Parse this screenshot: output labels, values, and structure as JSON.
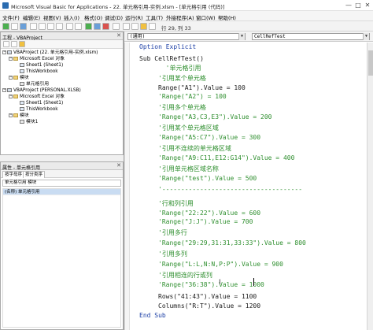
{
  "window": {
    "title": "Microsoft Visual Basic for Applications - 22. 单元格引用-实例.xlsm - [单元格引用 (代码)]",
    "minimize": "—",
    "maximize": "□",
    "close": "✕"
  },
  "menu": [
    "文件(F)",
    "编辑(E)",
    "视图(V)",
    "插入(I)",
    "格式(O)",
    "调试(D)",
    "运行(R)",
    "工具(T)",
    "外接程序(A)",
    "窗口(W)",
    "帮助(H)"
  ],
  "toolbar": {
    "position": "行 29, 列 33"
  },
  "project_panel": {
    "title": "工程 - VBAProject",
    "close": "✕",
    "tree": [
      {
        "label": "VBAProject (22. 单元格引用-实例.xlsm)",
        "toggle": "−",
        "icon": "proj"
      },
      {
        "label": "Microsoft Excel 对象",
        "toggle": "−",
        "icon": "folder"
      },
      {
        "label": "Sheet1 (Sheet1)",
        "toggle": "",
        "icon": "sheet"
      },
      {
        "label": "ThisWorkbook",
        "toggle": "",
        "icon": "sheet"
      },
      {
        "label": "模块",
        "toggle": "−",
        "icon": "folder"
      },
      {
        "label": "单元格引用",
        "toggle": "",
        "icon": "module"
      },
      {
        "label": "VBAProject (PERSONAL.XLSB)",
        "toggle": "−",
        "icon": "proj"
      },
      {
        "label": "Microsoft Excel 对象",
        "toggle": "−",
        "icon": "folder"
      },
      {
        "label": "Sheet1 (Sheet1)",
        "toggle": "",
        "icon": "sheet"
      },
      {
        "label": "ThisWorkbook",
        "toggle": "",
        "icon": "sheet"
      },
      {
        "label": "模块",
        "toggle": "−",
        "icon": "folder"
      },
      {
        "label": "模块1",
        "toggle": "",
        "icon": "module"
      }
    ]
  },
  "properties_panel": {
    "title": "属性 - 单元格引用",
    "close": "✕",
    "select": "单元格引用 模块",
    "tabs": [
      "按字母序",
      "按分类序"
    ],
    "rows": [
      {
        "label": "(名称) 单元格引用"
      }
    ]
  },
  "code_window": {
    "object_combo": "(通用)",
    "proc_combo": "CellRefTest"
  },
  "code": [
    {
      "text": "Option Explicit",
      "cls": "kw",
      "indent": 0
    },
    {
      "text": "Sub CellRefTest()",
      "cls": "",
      "indent": 0
    },
    {
      "text": "  '单元格引用",
      "cls": "cmt",
      "indent": 1
    },
    {
      "text": "'引用某个单元格",
      "cls": "cmt",
      "indent": 1
    },
    {
      "text": "Range(\"A1\").Value = 100",
      "cls": "",
      "indent": 1
    },
    {
      "text": "'Range(\"A2\") = 100",
      "cls": "cmt",
      "indent": 1
    },
    {
      "text": "'引用多个单元格",
      "cls": "cmt",
      "indent": 1
    },
    {
      "text": "'Range(\"A3,C3,E3\").Value = 200",
      "cls": "cmt",
      "indent": 1
    },
    {
      "text": "'引用某个单元格区域",
      "cls": "cmt",
      "indent": 1
    },
    {
      "text": "'Range(\"A5:C7\").Value = 300",
      "cls": "cmt",
      "indent": 1
    },
    {
      "text": "'引用不连续的单元格区域",
      "cls": "cmt",
      "indent": 1
    },
    {
      "text": "'Range(\"A9:C11,E12:G14\").Value = 400",
      "cls": "cmt",
      "indent": 1
    },
    {
      "text": "'引用单元格区域名称",
      "cls": "cmt",
      "indent": 1
    },
    {
      "text": "'Range(\"test\").Value = 500",
      "cls": "cmt",
      "indent": 1
    },
    {
      "text": "'-------------------------------------",
      "cls": "cmt",
      "indent": 1
    },
    {
      "text": "'行和列引用",
      "cls": "cmt",
      "indent": 1
    },
    {
      "text": "'Range(\"22:22\").Value = 600",
      "cls": "cmt",
      "indent": 1
    },
    {
      "text": "'Range(\"J:J\").Value = 700",
      "cls": "cmt",
      "indent": 1
    },
    {
      "text": "'引用多行",
      "cls": "cmt",
      "indent": 1
    },
    {
      "text": "'Range(\"29:29,31:31,33:33\").Value = 800",
      "cls": "cmt",
      "indent": 1
    },
    {
      "text": "'引用多列",
      "cls": "cmt",
      "indent": 1
    },
    {
      "text": "'Range(\"L:L,N:N,P:P\").Value = 900",
      "cls": "cmt",
      "indent": 1
    },
    {
      "text": "'引用相连的行或列",
      "cls": "cmt",
      "indent": 1
    },
    {
      "text": "'Range(\"36:38\").Value = 1000",
      "cls": "cmt",
      "indent": 1
    },
    {
      "text": "Rows(\"41:43\").Value = 1100",
      "cls": "",
      "indent": 1
    },
    {
      "text": "Columns(\"R:T\").Value = 1200",
      "cls": "",
      "indent": 1
    },
    {
      "text": "End Sub",
      "cls": "kw",
      "indent": 0
    }
  ]
}
